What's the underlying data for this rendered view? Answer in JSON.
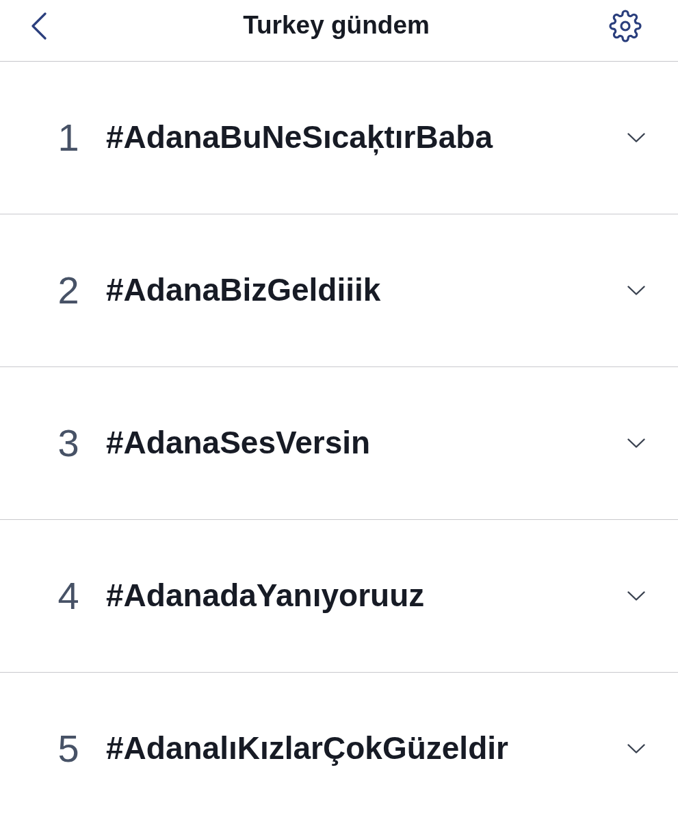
{
  "header": {
    "title": "Turkey gündem"
  },
  "trends": [
    {
      "rank": "1",
      "hashtag": "#AdanaBuNeSıcaķtırBaba"
    },
    {
      "rank": "2",
      "hashtag": "#AdanaBizGeldiiik"
    },
    {
      "rank": "3",
      "hashtag": "#AdanaSesVersin"
    },
    {
      "rank": "4",
      "hashtag": "#AdanadaYanıyoruuz"
    },
    {
      "rank": "5",
      "hashtag": "#AdanalıKızlarÇokGüzeldir"
    }
  ]
}
